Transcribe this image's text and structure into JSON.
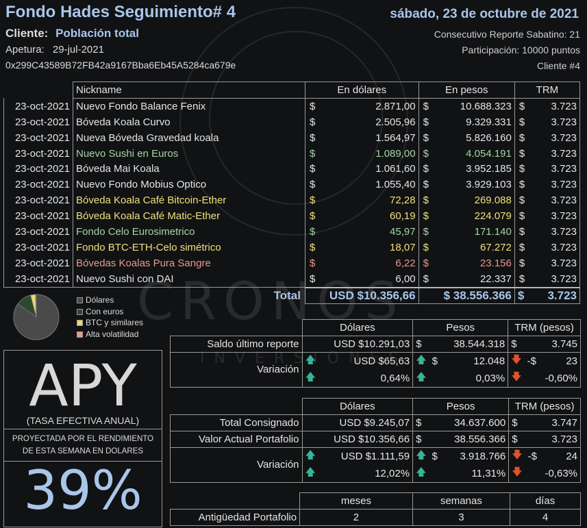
{
  "header": {
    "title": "Fondo Hades Seguimiento# 4",
    "date": "sábado, 23 de octubre de 2021",
    "client_label": "Cliente:",
    "client_value": "Población total",
    "opening_label": "Apetura:",
    "opening_value": "29-jul-2021",
    "address": "0x299C43589B72FB42a9167Bba6Eb45A5284ca679e",
    "report_number": "Consecutivo Reporte Sabatino: 21",
    "participation": "Participación: 10000 puntos",
    "client_number": "Cliente #4"
  },
  "watermark": {
    "brand": "CRONOS",
    "sub": "INVERSIONES"
  },
  "main_table": {
    "headers": [
      "Nickname",
      "En dólares",
      "En pesos",
      "TRM"
    ],
    "currency_symbol": "$",
    "rows": [
      {
        "date": "23-oct-2021",
        "name": "Nuevo Fondo Balance Fenix",
        "usd": "2.871,00",
        "cop": "10.688.323",
        "trm": "3.723",
        "color": "#e6e6e6"
      },
      {
        "date": "23-oct-2021",
        "name": "Bóveda Koala Curvo",
        "usd": "2.505,96",
        "cop": "9.329.331",
        "trm": "3.723",
        "color": "#e6e6e6"
      },
      {
        "date": "23-oct-2021",
        "name": "Nueva Bóveda Gravedad koala",
        "usd": "1.564,97",
        "cop": "5.826.160",
        "trm": "3.723",
        "color": "#e6e6e6"
      },
      {
        "date": "23-oct-2021",
        "name": "Nuevo Sushi en Euros",
        "usd": "1.089,00",
        "cop": "4.054.191",
        "trm": "3.723",
        "color": "#a4d6a4"
      },
      {
        "date": "23-oct-2021",
        "name": "Bóveda Mai Koala",
        "usd": "1.061,60",
        "cop": "3.952.185",
        "trm": "3.723",
        "color": "#e6e6e6"
      },
      {
        "date": "23-oct-2021",
        "name": "Nuevo Fondo Mobius Optico",
        "usd": "1.055,40",
        "cop": "3.929.103",
        "trm": "3.723",
        "color": "#e6e6e6"
      },
      {
        "date": "23-oct-2021",
        "name": "Bóveda Koala Café Bitcoin-Ether",
        "usd": "72,28",
        "cop": "269.088",
        "trm": "3.723",
        "color": "#f0e17a"
      },
      {
        "date": "23-oct-2021",
        "name": "Bóveda Koala Café Matic-Ether",
        "usd": "60,19",
        "cop": "224.079",
        "trm": "3.723",
        "color": "#f0e17a"
      },
      {
        "date": "23-oct-2021",
        "name": "Fondo Celo Eurosimetrico",
        "usd": "45,97",
        "cop": "171.140",
        "trm": "3.723",
        "color": "#a4d6a4"
      },
      {
        "date": "23-oct-2021",
        "name": "Fondo BTC-ETH-Celo simétrico",
        "usd": "18,07",
        "cop": "67.272",
        "trm": "3.723",
        "color": "#f0e17a"
      },
      {
        "date": "23-oct-2021",
        "name": "Bóvedas Koalas Pura Sangre",
        "usd": "6,22",
        "cop": "23.156",
        "trm": "3.723",
        "color": "#e89a8a"
      },
      {
        "date": "23-oct-2021",
        "name": "Nuevo Sushi con DAI",
        "usd": "6,00",
        "cop": "22.337",
        "trm": "3.723",
        "color": "#e6e6e6"
      }
    ],
    "total_label": "Total",
    "total_usd": "USD $10.356,66",
    "total_cop": "$ 38.556.366",
    "total_trm_symbol": "$",
    "total_trm": "3.723"
  },
  "pie": {
    "legend": [
      {
        "label": "Dólares",
        "color": "#4a4a4a"
      },
      {
        "label": "Con euros",
        "color": "#2e4a2e"
      },
      {
        "label": "BTC y similares",
        "color": "#e8d873"
      },
      {
        "label": "Alta volatilidad",
        "color": "#e89a8a"
      }
    ],
    "fractions": [
      0.849,
      0.11,
      0.036,
      0.0006
    ]
  },
  "saldo_table": {
    "headers": [
      "Dólares",
      "Pesos",
      "TRM (pesos)"
    ],
    "saldo_label": "Saldo último reporte",
    "saldo_usd": "USD $10.291,03",
    "saldo_cop": "38.544.318",
    "saldo_trm": "3.745",
    "variation_label": "Variación",
    "var_usd": "USD $65,63",
    "var_cop": "12.048",
    "var_trm": "23",
    "var_trm_prefix": "-$",
    "var_usd_pct": "0,64%",
    "var_cop_pct": "0,03%",
    "var_trm_pct": "-0,60%"
  },
  "portfolio_table": {
    "headers": [
      "Dólares",
      "Pesos",
      "TRM (pesos)"
    ],
    "consignado_label": "Total Consignado",
    "consignado_usd": "USD $9.245,07",
    "consignado_cop": "34.637.600",
    "consignado_trm": "3.747",
    "actual_label": "Valor Actual Portafolio",
    "actual_usd": "USD $10.356,66",
    "actual_cop": "38.556.366",
    "actual_trm": "3.723",
    "variation_label": "Variación",
    "var_usd": "USD $1.111,59",
    "var_cop": "3.918.766",
    "var_trm": "24",
    "var_trm_prefix": "-$",
    "var_usd_pct": "12,02%",
    "var_cop_pct": "11,31%",
    "var_trm_pct": "-0,63%"
  },
  "age_table": {
    "headers": [
      "meses",
      "semanas",
      "días"
    ],
    "label": "Antigüedad Portafolio",
    "months": "2",
    "weeks": "3",
    "days": "4"
  },
  "apy": {
    "big": "APY",
    "subtitle": "(TASA EFECTIVA ANUAL)",
    "desc_line1": "PROYECTADA POR EL RENDIMIENTO",
    "desc_line2": "DE ESTA SEMANA EN DOLARES",
    "value": "39%"
  },
  "icons": {
    "up": "arrow-up-icon",
    "down": "arrow-down-icon"
  }
}
